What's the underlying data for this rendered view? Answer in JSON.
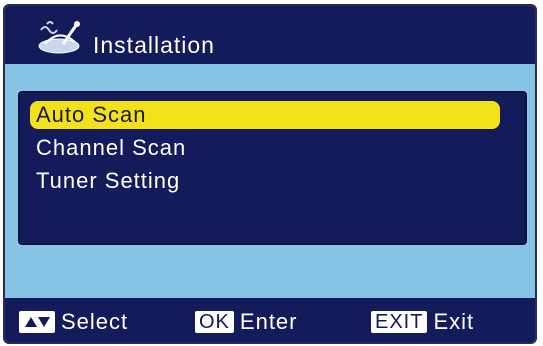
{
  "title_bar": {
    "icon": "satellite-dish-icon",
    "title": "Installation"
  },
  "menu": {
    "items": [
      {
        "label": "Auto Scan",
        "selected": true
      },
      {
        "label": "Channel Scan",
        "selected": false
      },
      {
        "label": "Tuner Setting",
        "selected": false
      }
    ]
  },
  "footer": {
    "hints": [
      {
        "key_icon": "up-down-arrows-icon",
        "key": "",
        "label": "Select"
      },
      {
        "key": "OK",
        "label": "Enter"
      },
      {
        "key": "EXIT",
        "label": "Exit"
      }
    ]
  },
  "colors": {
    "panel_blue": "#141b5a",
    "background_light_blue": "#88c4e6",
    "highlight_yellow": "#f3e21a",
    "text_white": "#ffffff"
  }
}
